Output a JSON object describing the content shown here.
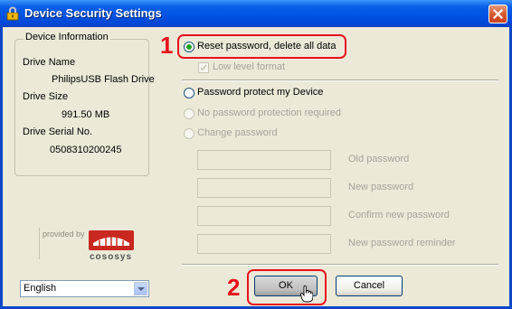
{
  "window": {
    "title": "Device Security Settings"
  },
  "device_info": {
    "legend": "Device Information",
    "drive_name_label": "Drive Name",
    "drive_name": "PhilipsUSB Flash Drive",
    "drive_size_label": "Drive Size",
    "drive_size": "991.50 MB",
    "serial_label": "Drive Serial No.",
    "serial": "0508310200245"
  },
  "options": {
    "reset": "Reset password, delete all data",
    "low_level": "Low level format",
    "protect": "Password protect my Device",
    "no_protection": "No password protection required",
    "change": "Change password"
  },
  "fields": {
    "old": "Old password",
    "new": "New password",
    "confirm": "Confirm new password",
    "reminder": "New password reminder"
  },
  "branding": {
    "provided_by": "provided by",
    "logo_text": "cososys"
  },
  "language": {
    "selected": "English"
  },
  "buttons": {
    "ok": "OK",
    "cancel": "Cancel"
  },
  "annotations": {
    "step1": "1",
    "step2": "2"
  },
  "colors": {
    "accent": "#0054e3",
    "annotation": "#e8101b",
    "radio_selected": "#21a121",
    "logo_red": "#c8281e"
  },
  "state": {
    "selected_option": "reset",
    "low_level_checked": false
  }
}
